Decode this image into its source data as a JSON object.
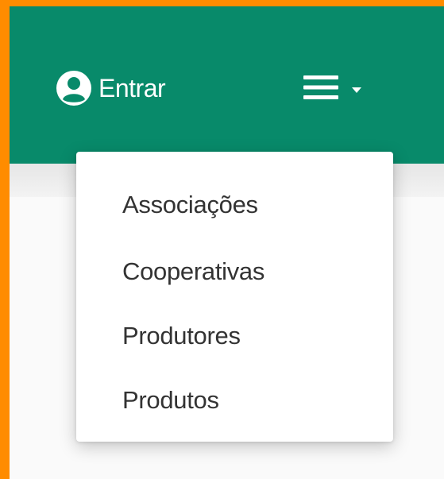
{
  "colors": {
    "frame": "#ff8c00",
    "header": "#088a6a",
    "dropdown_bg": "#ffffff",
    "menu_text": "#333333"
  },
  "header": {
    "login_icon": "user-circle-icon",
    "login_label": "Entrar",
    "menu_icon": "hamburger-icon",
    "menu_caret_icon": "caret-down-icon"
  },
  "dropdown": {
    "items": [
      {
        "label": "Associações"
      },
      {
        "label": "Cooperativas"
      },
      {
        "label": "Produtores"
      },
      {
        "label": "Produtos"
      }
    ]
  }
}
